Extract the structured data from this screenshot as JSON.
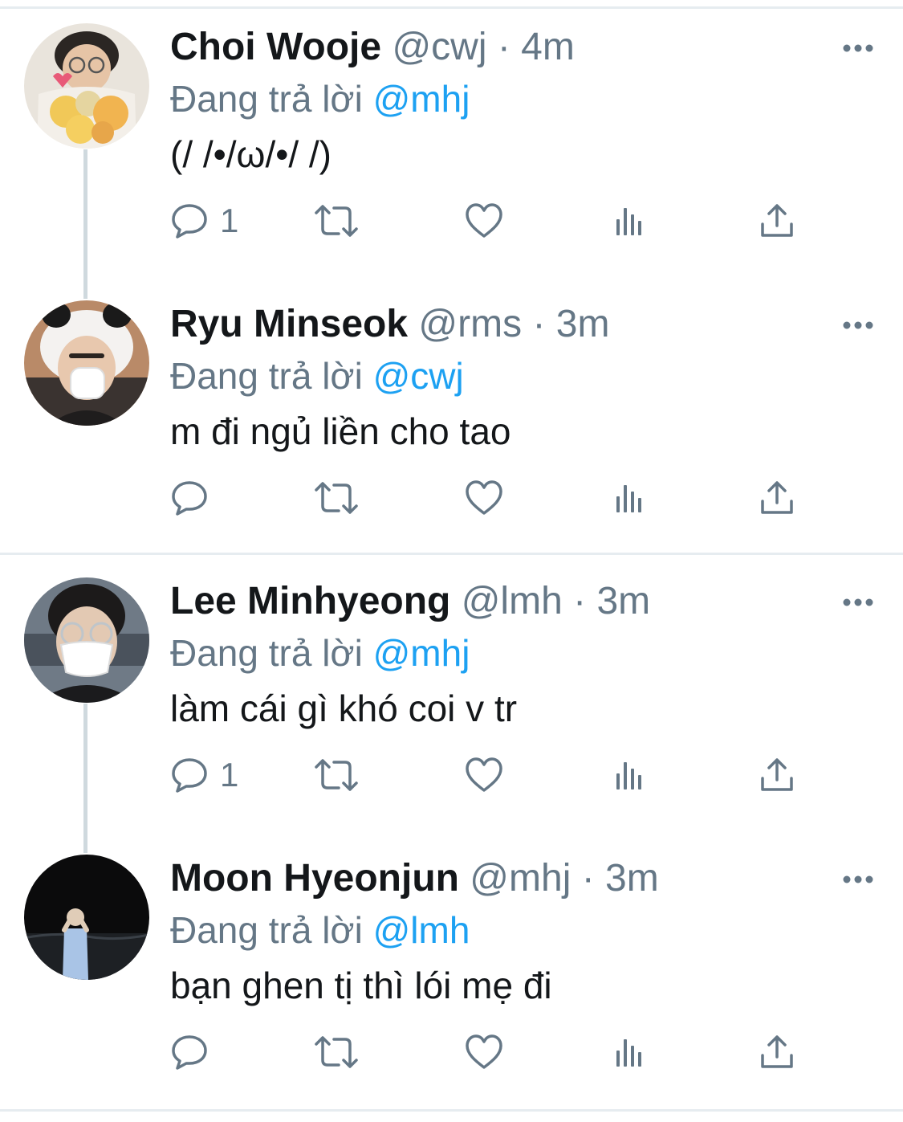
{
  "colors": {
    "text": "#14171a",
    "muted": "#657786",
    "link": "#1da1f2",
    "divider": "#e6ecf0",
    "thread_line": "#cfd9de"
  },
  "icons": {
    "reply": "speech-bubble-icon",
    "retweet": "retweet-arrows-icon",
    "like": "heart-icon",
    "views": "bar-chart-icon",
    "share": "share-upload-icon",
    "more": "more-dots-icon"
  },
  "tweets": [
    {
      "name": "Choi Wooje",
      "handle": "@cwj",
      "separator": "·",
      "time": "4m",
      "replying_prefix": "Đang trả lời",
      "replying_to": "@mhj",
      "text": "(/ /•/ω/•/ /)",
      "reply_count": "1"
    },
    {
      "name": "Ryu Minseok",
      "handle": "@rms",
      "separator": "·",
      "time": "3m",
      "replying_prefix": "Đang trả lời",
      "replying_to": "@cwj",
      "text": "m đi ngủ liền cho tao",
      "reply_count": ""
    },
    {
      "name": "Lee Minhyeong",
      "handle": "@lmh",
      "separator": "·",
      "time": "3m",
      "replying_prefix": "Đang trả lời",
      "replying_to": "@mhj",
      "text": "làm cái gì khó coi v tr",
      "reply_count": "1"
    },
    {
      "name": "Moon Hyeonjun",
      "handle": "@mhj",
      "separator": "·",
      "time": "3m",
      "replying_prefix": "Đang trả lời",
      "replying_to": "@lmh",
      "text": "bạn ghen tị thì lói mẹ đi",
      "reply_count": ""
    }
  ]
}
